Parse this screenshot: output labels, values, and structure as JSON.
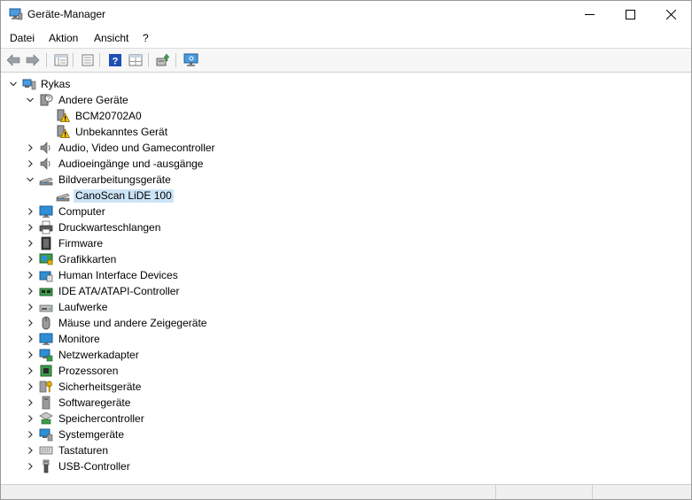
{
  "window": {
    "title": "Geräte-Manager"
  },
  "menu": [
    {
      "id": "datei",
      "label": "Datei"
    },
    {
      "id": "aktion",
      "label": "Aktion"
    },
    {
      "id": "ansicht",
      "label": "Ansicht"
    },
    {
      "id": "hilfe",
      "label": "?"
    }
  ],
  "toolbar": {
    "buttons": [
      "back-icon",
      "forward-icon",
      "properties-view-icon",
      "list-view-icon",
      "help-icon",
      "grid-view-icon",
      "update-driver-icon",
      "scan-hardware-icon"
    ]
  },
  "tree": {
    "root": "Rykas",
    "nodes": [
      {
        "label": "Andere Geräte",
        "icon": "unknown-device-icon",
        "expanded": true
      },
      {
        "label": "BCM20702A0",
        "icon": "warning-device-icon",
        "child": true
      },
      {
        "label": "Unbekanntes Gerät",
        "icon": "warning-device-icon",
        "child": true
      },
      {
        "label": "Audio, Video und Gamecontroller",
        "icon": "speaker-icon"
      },
      {
        "label": "Audioeingänge und -ausgänge",
        "icon": "speaker-icon"
      },
      {
        "label": "Bildverarbeitungsgeräte",
        "icon": "scanner-icon",
        "expanded": true
      },
      {
        "label": "CanoScan LiDE 100",
        "icon": "scanner-icon",
        "child": true,
        "selected": true
      },
      {
        "label": "Computer",
        "icon": "monitor-icon"
      },
      {
        "label": "Druckwarteschlangen",
        "icon": "printer-icon"
      },
      {
        "label": "Firmware",
        "icon": "chip-icon"
      },
      {
        "label": "Grafikkarten",
        "icon": "display-adapter-icon"
      },
      {
        "label": "Human Interface Devices",
        "icon": "hid-icon"
      },
      {
        "label": "IDE ATA/ATAPI-Controller",
        "icon": "ide-controller-icon"
      },
      {
        "label": "Laufwerke",
        "icon": "drive-icon"
      },
      {
        "label": "Mäuse und andere Zeigegeräte",
        "icon": "mouse-icon"
      },
      {
        "label": "Monitore",
        "icon": "monitor-icon"
      },
      {
        "label": "Netzwerkadapter",
        "icon": "network-icon"
      },
      {
        "label": "Prozessoren",
        "icon": "processor-icon"
      },
      {
        "label": "Sicherheitsgeräte",
        "icon": "security-key-icon"
      },
      {
        "label": "Softwaregeräte",
        "icon": "software-device-icon"
      },
      {
        "label": "Speichercontroller",
        "icon": "storage-controller-icon"
      },
      {
        "label": "Systemgeräte",
        "icon": "system-device-icon"
      },
      {
        "label": "Tastaturen",
        "icon": "keyboard-icon"
      },
      {
        "label": "USB-Controller",
        "icon": "usb-icon"
      }
    ]
  },
  "colors": {
    "selection": "#cce4f7",
    "help_blue": "#1f4fb5",
    "monitor_blue": "#2f8fd6"
  }
}
